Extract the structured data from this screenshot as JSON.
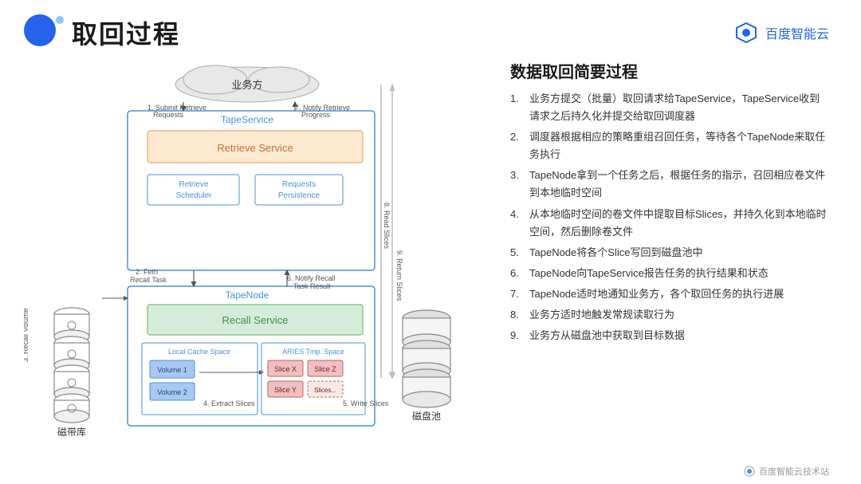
{
  "header": {
    "title": "取回过程",
    "logo_text": "百度智能云"
  },
  "diagram": {
    "cloud_label": "业务方",
    "tapeservice_label": "TapeService",
    "retrieve_service_label": "Retrieve Service",
    "retrieve_scheduler_label": "Retrieve Scheduler",
    "requests_persistence_label": "Requests Persistence",
    "tapenode_label": "TapeNode",
    "recall_service_label": "Recall Service",
    "local_cache_space_label": "Local Cache Space",
    "aries_tmp_space_label": "ARIES Tmp. Space",
    "volume1_label": "Volume 1",
    "volume2_label": "Volume 2",
    "slice_x_label": "Slice X",
    "slice_y_label": "Slice Y",
    "slice_z_label": "Slice Z",
    "slices_label": "Slices...",
    "tape_library_label": "磁带库",
    "disk_pool_label": "磁盘池",
    "arrow1_label": "1. Submit Retrieve Requests",
    "arrow2_label": "2. Feth Recall Task",
    "arrow3_label": "3. Recall Volume",
    "arrow4_label": "4. Extract Slices",
    "arrow5_label": "5. Write Slices",
    "arrow6_label": "6. Notify Recall Task Result",
    "arrow7_label": "7. Notify Retrieve Progress",
    "arrow8_label": "8. Read Slices",
    "arrow9_label": "9. Return Slices"
  },
  "summary": {
    "title": "数据取回简要过程",
    "items": [
      {
        "num": "1.",
        "text": "业务方提交（批量）取回请求给TapeService，TapeService收到请求之后持久化并提交给取回调度器"
      },
      {
        "num": "2.",
        "text": "调度器根据相应的策略重组召回任务，等待各个TapeNode来取任务执行"
      },
      {
        "num": "3.",
        "text": "TapeNode拿到一个任务之后，根据任务的指示，召回相应卷文件到本地临时空间"
      },
      {
        "num": "4.",
        "text": "从本地临时空间的卷文件中提取目标Slices，并持久化到本地临时空间，然后删除卷文件"
      },
      {
        "num": "5.",
        "text": "TapeNode将各个Slice写回到磁盘池中"
      },
      {
        "num": "6.",
        "text": "TapeNode向TapeService报告任务的执行结果和状态"
      },
      {
        "num": "7.",
        "text": "TapeNode适时地通知业务方，各个取回任务的执行进展"
      },
      {
        "num": "8.",
        "text": "业务方适时地触发常规读取行为"
      },
      {
        "num": "9.",
        "text": "业务方从磁盘池中获取到目标数据"
      }
    ]
  },
  "watermark": {
    "text": "百度智能云技术站"
  }
}
